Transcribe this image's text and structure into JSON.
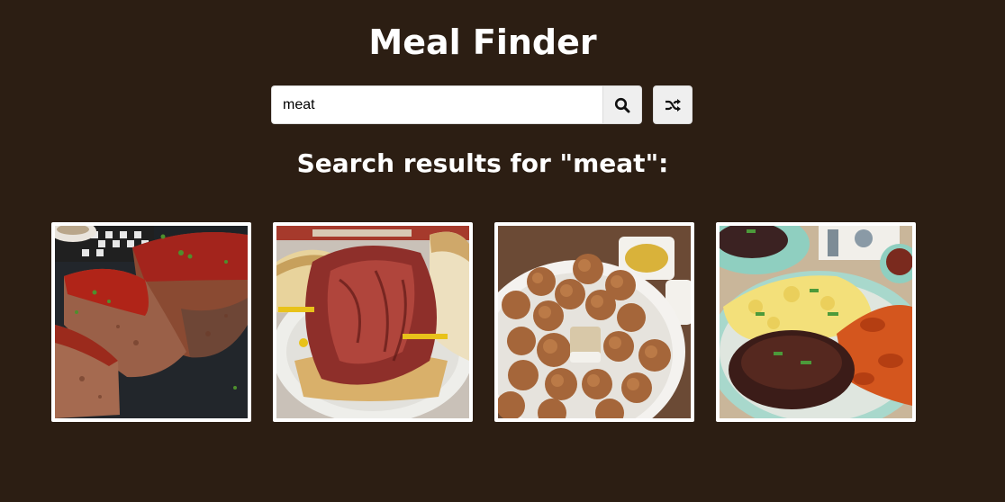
{
  "header": {
    "title": "Meal Finder"
  },
  "search": {
    "value": "meat",
    "submit_icon": "search-icon",
    "random_icon": "random-shuffle-icon"
  },
  "results": {
    "heading_prefix": "Search results for \"",
    "query": "meat",
    "heading_suffix": "\":"
  },
  "meals": [
    {
      "image": "meatloaf-photo"
    },
    {
      "image": "pastrami-sandwich-photo"
    },
    {
      "image": "fried-meatballs-bowl-photo"
    },
    {
      "image": "hamburger-steak-plate-photo"
    }
  ],
  "colors": {
    "background": "#2c1e13",
    "text": "#ffffff",
    "button": "#efefef"
  }
}
